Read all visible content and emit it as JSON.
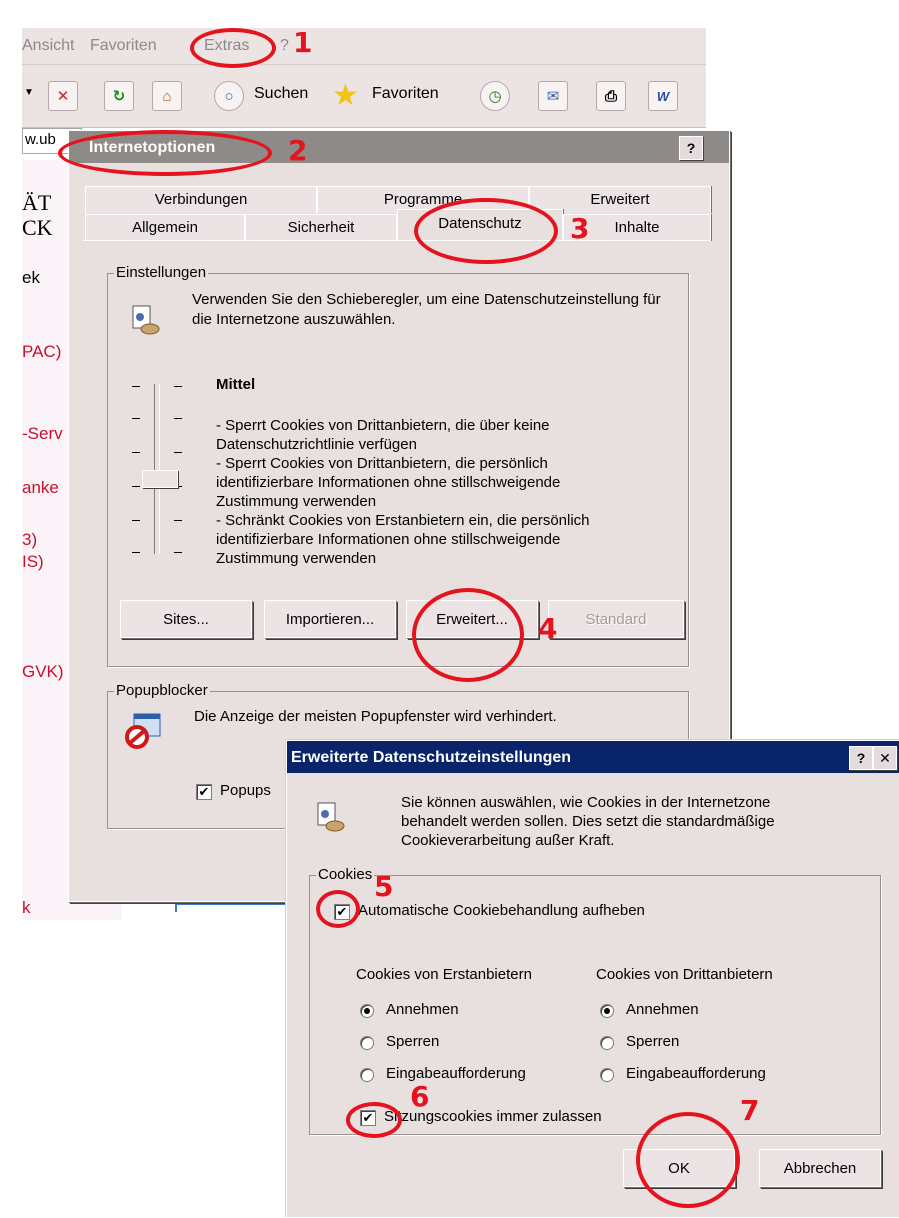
{
  "browser": {
    "menu": [
      "Ansicht",
      "Favoriten",
      "Extras",
      "?"
    ],
    "toolbar": {
      "search": "Suchen",
      "favorites": "Favoriten"
    },
    "address_partial": "w.ub",
    "sidebar_fragments": [
      "ÄT",
      "CK",
      "ek",
      "PAC)",
      "-Serv",
      "anke",
      "3)",
      "IS)",
      "GVK)",
      "k"
    ]
  },
  "io": {
    "title": "Internetoptionen",
    "tabs_back": [
      "Verbindungen",
      "Programme",
      "Erweitert"
    ],
    "tabs_front": [
      "Allgemein",
      "Sicherheit",
      "Datenschutz",
      "Inhalte"
    ],
    "settings": {
      "label": "Einstellungen",
      "intro": "Verwenden Sie den Schieberegler, um eine Datenschutzeinstellung für die Internetzone auszuwählen.",
      "level": "Mittel",
      "desc": [
        "- Sperrt Cookies von Drittanbietern, die über keine",
        "Datenschutzrichtlinie verfügen",
        "- Sperrt Cookies von Drittanbietern, die persönlich",
        "identifizierbare Informationen ohne stillschweigende",
        "Zustimmung verwenden",
        "- Schränkt Cookies von Erstanbietern ein, die persönlich",
        "identifizierbare Informationen ohne stillschweigende",
        "Zustimmung verwenden"
      ],
      "buttons": {
        "sites": "Sites...",
        "import": "Importieren...",
        "advanced": "Erweitert...",
        "default": "Standard"
      }
    },
    "popup": {
      "label": "Popupblocker",
      "text": "Die Anzeige der meisten Popupfenster wird verhindert.",
      "checkbox": "Popups"
    }
  },
  "ed": {
    "title": "Erweiterte Datenschutzeinstellungen",
    "intro": [
      "Sie können auswählen, wie Cookies in der Internetzone",
      "behandelt werden sollen. Dies setzt die standardmäßige",
      "Cookieverarbeitung außer Kraft."
    ],
    "group": "Cookies",
    "override": "Automatische Cookiebehandlung aufheben",
    "col1": "Cookies von Erstanbietern",
    "col2": "Cookies von Drittanbietern",
    "options": [
      "Annehmen",
      "Sperren",
      "Eingabeaufforderung"
    ],
    "session": "Sitzungscookies immer zulassen",
    "ok": "OK",
    "cancel": "Abbrechen"
  },
  "annotations": [
    "1",
    "2",
    "3",
    "4",
    "5",
    "6",
    "7"
  ],
  "colors": {
    "annotation": "#e4131d",
    "active_title": "#0a246a",
    "inactive_title": "#8e8a87"
  }
}
